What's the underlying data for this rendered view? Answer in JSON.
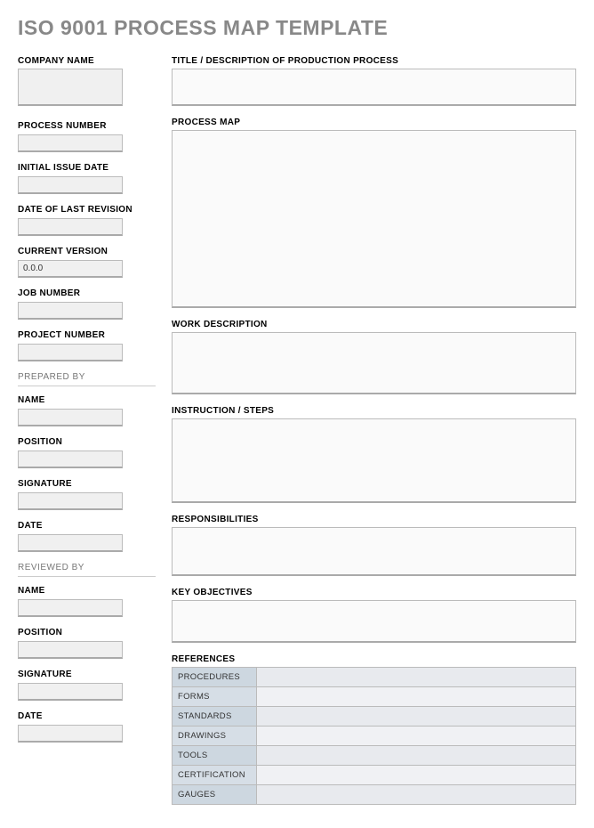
{
  "title": "ISO 9001 PROCESS MAP TEMPLATE",
  "left": {
    "company_name_label": "COMPANY NAME",
    "company_name": "",
    "process_number_label": "PROCESS NUMBER",
    "process_number": "",
    "initial_issue_date_label": "INITIAL ISSUE DATE",
    "initial_issue_date": "",
    "date_last_revision_label": "DATE OF LAST REVISION",
    "date_last_revision": "",
    "current_version_label": "CURRENT VERSION",
    "current_version": "0.0.0",
    "job_number_label": "JOB NUMBER",
    "job_number": "",
    "project_number_label": "PROJECT NUMBER",
    "project_number": "",
    "prepared_by_header": "PREPARED BY",
    "prepared_name_label": "NAME",
    "prepared_name": "",
    "prepared_position_label": "POSITION",
    "prepared_position": "",
    "prepared_signature_label": "SIGNATURE",
    "prepared_signature": "",
    "prepared_date_label": "DATE",
    "prepared_date": "",
    "reviewed_by_header": "REVIEWED BY",
    "reviewed_name_label": "NAME",
    "reviewed_name": "",
    "reviewed_position_label": "POSITION",
    "reviewed_position": "",
    "reviewed_signature_label": "SIGNATURE",
    "reviewed_signature": "",
    "reviewed_date_label": "DATE",
    "reviewed_date": ""
  },
  "right": {
    "title_desc_label": "TITLE / DESCRIPTION OF PRODUCTION PROCESS",
    "title_desc": "",
    "process_map_label": "PROCESS MAP",
    "process_map": "",
    "work_desc_label": "WORK DESCRIPTION",
    "work_desc": "",
    "instruction_label": "INSTRUCTION / STEPS",
    "instruction": "",
    "responsibilities_label": "RESPONSIBILITIES",
    "responsibilities": "",
    "key_objectives_label": "KEY OBJECTIVES",
    "key_objectives": "",
    "references_label": "REFERENCES",
    "references": [
      {
        "label": "PROCEDURES",
        "value": ""
      },
      {
        "label": "FORMS",
        "value": ""
      },
      {
        "label": "STANDARDS",
        "value": ""
      },
      {
        "label": "DRAWINGS",
        "value": ""
      },
      {
        "label": "TOOLS",
        "value": ""
      },
      {
        "label": "CERTIFICATION",
        "value": ""
      },
      {
        "label": "GAUGES",
        "value": ""
      }
    ]
  }
}
